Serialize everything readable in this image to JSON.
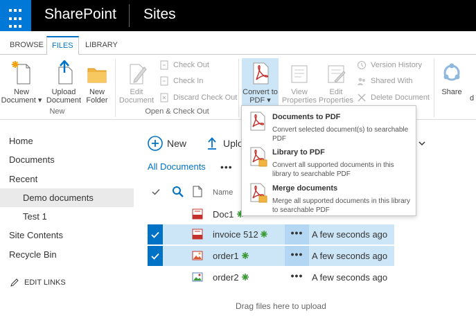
{
  "suite": {
    "brand": "SharePoint",
    "app": "Sites"
  },
  "ribbon": {
    "tabs": [
      "BROWSE",
      "FILES",
      "LIBRARY"
    ],
    "active_tab": "FILES",
    "new_group": {
      "label": "New",
      "new_document": "New\nDocument ▾",
      "new_document_l1": "New",
      "new_document_l2": "Document",
      "upload_l1": "Upload",
      "upload_l2": "Document",
      "folder_l1": "New",
      "folder_l2": "Folder"
    },
    "open_group": {
      "label": "Open & Check Out",
      "edit_l1": "Edit",
      "edit_l2": "Document",
      "check_out": "Check Out",
      "check_in": "Check In",
      "discard": "Discard Check Out"
    },
    "convert": {
      "l1": "Convert to",
      "l2": "PDF"
    },
    "manage": {
      "view_l1": "View",
      "view_l2": "Properties",
      "edit_l1": "Edit",
      "edit_l2": "Properties",
      "version_history": "Version History",
      "shared_with": "Shared With",
      "delete": "Delete Document"
    },
    "share": "Share",
    "cut_char": "d"
  },
  "dropdown": {
    "items": [
      {
        "title": "Documents to PDF",
        "desc": "Convert selected document(s) to searchable PDF"
      },
      {
        "title": "Library to PDF",
        "desc": "Convert all supported documents in this library to searchable PDF"
      },
      {
        "title": "Merge documents",
        "desc": "Merge all supported documents in this library to searchable PDF"
      }
    ]
  },
  "nav": {
    "items": [
      "Home",
      "Documents",
      "Recent",
      "Demo documents",
      "Test 1",
      "Site Contents",
      "Recycle Bin"
    ],
    "edit_links": "EDIT LINKS"
  },
  "commands": {
    "new": "New",
    "upload": "Uplo"
  },
  "view": {
    "name": "All Documents",
    "more": "•••"
  },
  "list": {
    "name_header": "Name",
    "rows": [
      {
        "name": "Doc1",
        "icon": "pdf-icon",
        "selected": false,
        "modified": ""
      },
      {
        "name": "invoice 512",
        "icon": "pdf-icon",
        "selected": true,
        "modified": "A few seconds ago"
      },
      {
        "name": "order1",
        "icon": "image-icon",
        "selected": true,
        "modified": "A few seconds ago"
      },
      {
        "name": "order2",
        "icon": "image-icon",
        "selected": false,
        "modified": "A few seconds ago"
      }
    ],
    "menu_glyph": "•••",
    "drag_hint": "Drag files here to upload"
  },
  "colors": {
    "accent": "#0072c6",
    "waffle": "#0078d7",
    "selection": "#cde6f7",
    "suitebar": "#000000",
    "pdf_red": "#c4302b",
    "new_green": "#3a9b35"
  }
}
